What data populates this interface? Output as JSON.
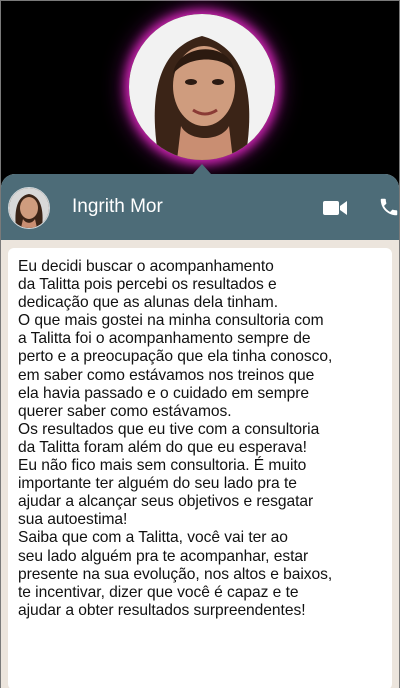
{
  "contact": {
    "name": "Ingrith Mor"
  },
  "header": {
    "video_icon": "video-call-icon",
    "phone_icon": "phone-call-icon",
    "background_color": "#4d6c78"
  },
  "message": {
    "text": "Eu decidi buscar o acompanhamento\nda Talitta pois percebi os resultados e\ndedicação que as alunas dela tinham.\nO que mais gostei na minha consultoria com\na Talitta foi o acompanhamento sempre de\nperto e a preocupação que ela tinha conosco,\nem saber como estávamos nos treinos que\nela havia passado e o cuidado em sempre\nquerer saber como estávamos.\nOs resultados que eu tive com a consultoria\nda Talitta foram além do que eu esperava!\nEu não fico mais sem consultoria. É muito\nimportante ter alguém do seu lado pra te\najudar a alcançar seus objetivos e resgatar\nsua autoestima!\nSaiba que com a Talitta, você vai ter ao\nseu lado alguém pra te acompanhar, estar\npresente na sua evolução, nos altos e baixos,\nte incentivar, dizer que você é capaz e te\najudar a obter resultados surpreendentes!"
  },
  "colors": {
    "glow": "#dc28be",
    "chat_background": "#ece5dd",
    "bubble": "#ffffff"
  }
}
